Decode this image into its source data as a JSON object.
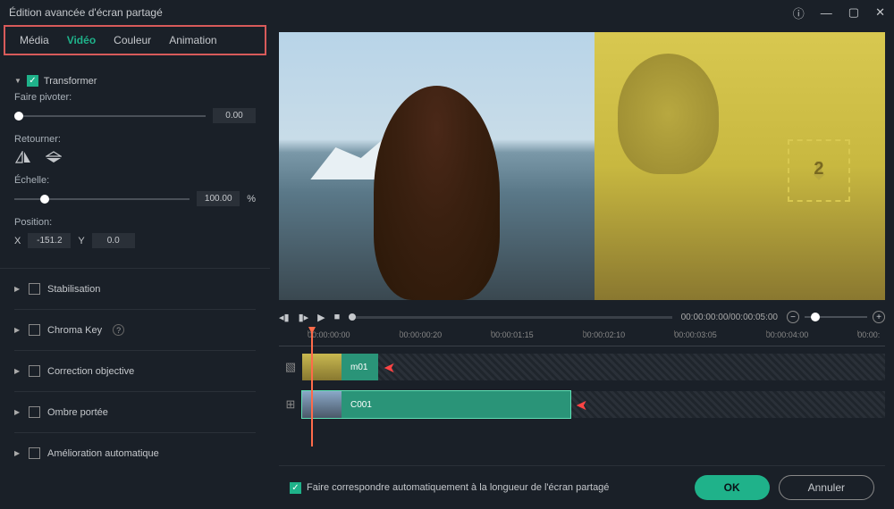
{
  "window": {
    "title": "Édition avancée d'écran partagé"
  },
  "tabs": {
    "media": "Média",
    "video": "Vidéo",
    "color": "Couleur",
    "animation": "Animation"
  },
  "transform": {
    "header": "Transformer",
    "rotate_label": "Faire pivoter:",
    "rotate_value": "0.00",
    "flip_label": "Retourner:",
    "scale_label": "Échelle:",
    "scale_value": "100.00",
    "scale_unit": "%",
    "position_label": "Position:",
    "x_label": "X",
    "x_value": "-151.2",
    "y_label": "Y",
    "y_value": "0.0"
  },
  "groups": {
    "stabilisation": "Stabilisation",
    "chroma": "Chroma Key",
    "correction": "Correction objective",
    "ombre": "Ombre portée",
    "amelioration": "Amélioration automatique"
  },
  "preview": {
    "download_num": "2"
  },
  "player": {
    "timecode": "00:00:00:00/00:00:05:00"
  },
  "timeline": {
    "ticks": [
      "00:00:00:00",
      "00:00:00:20",
      "00:00:01:15",
      "00:00:02:10",
      "00:00:03:05",
      "00:00:04:00",
      "00:00:"
    ],
    "clip1_label": "m01",
    "clip2_label": "C001"
  },
  "footer": {
    "checkbox_label": "Faire correspondre automatiquement à la longueur de l'écran partagé",
    "ok": "OK",
    "cancel": "Annuler"
  }
}
